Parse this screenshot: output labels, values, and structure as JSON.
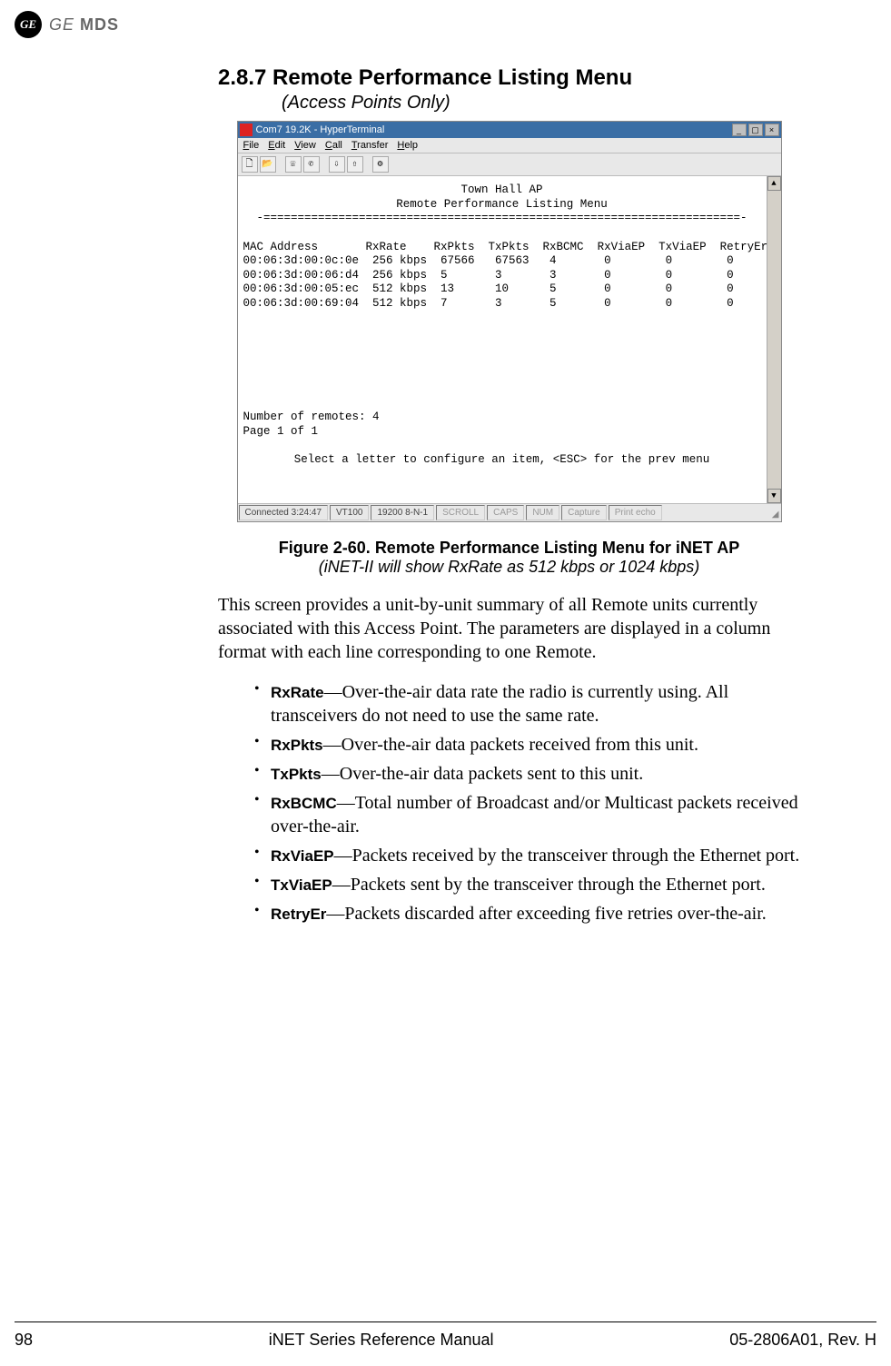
{
  "header": {
    "logo_text": "GE",
    "brand_ge": "GE",
    "brand_mds": "MDS"
  },
  "section": {
    "number_title": "2.8.7 Remote Performance Listing Menu",
    "subtitle": "(Access Points Only)"
  },
  "terminal": {
    "window_title": "Com7 19.2K - HyperTerminal",
    "menus": {
      "file": "File",
      "edit": "Edit",
      "view": "View",
      "call": "Call",
      "transfer": "Transfer",
      "help": "Help"
    },
    "title1": "Town Hall AP",
    "title2": "Remote Performance Listing Menu",
    "divider": "-======================================================================-",
    "columns": "MAC Address       RxRate    RxPkts  TxPkts  RxBCMC  RxViaEP  TxViaEP  RetryErrs",
    "rows": [
      "00:06:3d:00:0c:0e  256 kbps  67566   67563   4       0        0        0",
      "00:06:3d:00:06:d4  256 kbps  5       3       3       0        0        0",
      "00:06:3d:00:05:ec  512 kbps  13      10      5       0        0        0",
      "00:06:3d:00:69:04  512 kbps  7       3       5       0        0        0"
    ],
    "num_remotes": "Number of remotes: 4",
    "page_info": "Page 1 of 1",
    "prompt": "Select a letter to configure an item, <ESC> for the prev menu",
    "status": {
      "connected": "Connected 3:24:47",
      "emu": "VT100",
      "baud": "19200 8-N-1",
      "scroll": "SCROLL",
      "caps": "CAPS",
      "num": "NUM",
      "capture": "Capture",
      "print": "Print echo"
    }
  },
  "figure": {
    "caption": "Figure 2-60. Remote Performance Listing Menu for iNET AP",
    "subcaption": "(iNET-II will show RxRate as 512 kbps or 1024 kbps)"
  },
  "body": {
    "intro": "This screen provides a unit-by-unit summary of all Remote units currently associated with this Access Point. The parameters are displayed in a column format with each line corresponding to one Remote."
  },
  "params": [
    {
      "term": "RxRate",
      "desc": "—Over-the-air data rate the radio is currently using. All transceivers do not need to use the same rate."
    },
    {
      "term": "RxPkts",
      "desc": "—Over-the-air data packets received from this unit."
    },
    {
      "term": "TxPkts",
      "desc": "—Over-the-air data packets sent to this unit."
    },
    {
      "term": "RxBCMC",
      "desc": "—Total number of Broadcast and/or Multicast packets received over-the-air."
    },
    {
      "term": "RxViaEP",
      "desc": "—Packets received by the transceiver through the Ethernet port."
    },
    {
      "term": "TxViaEP",
      "desc": "—Packets sent by the transceiver through the Ethernet port."
    },
    {
      "term": "RetryEr",
      "desc": "—Packets discarded after exceeding five retries over-the-air."
    }
  ],
  "footer": {
    "page": "98",
    "center": "iNET Series Reference Manual",
    "right": "05-2806A01, Rev. H"
  }
}
